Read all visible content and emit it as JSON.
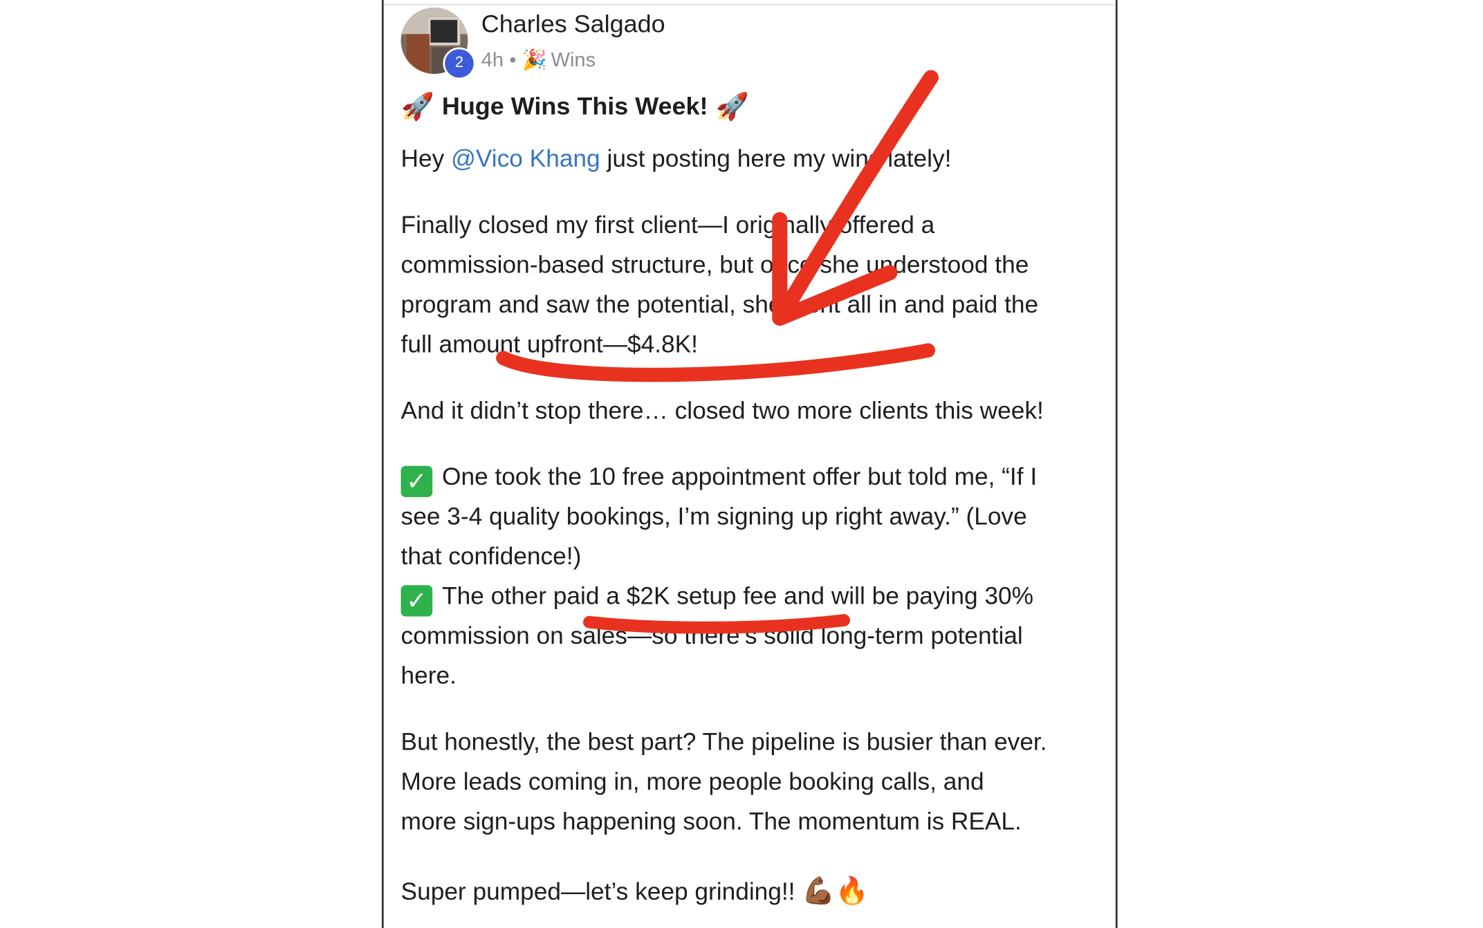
{
  "post": {
    "author": "Charles Salgado",
    "level": "2",
    "time": "4h",
    "separator": "•",
    "category_icon": "party-popper-icon",
    "category": "Wins",
    "title_icon": "rocket-icon",
    "title": "Huge Wins This Week!",
    "intro_before": "Hey ",
    "mention": "@Vico Khang",
    "intro_after": " just posting here my wins lately!",
    "p1": [
      "Finally closed my first client—I originally offered a",
      "commission-based structure, but once she understood the",
      "program and saw the potential, she went all in and paid the",
      "full amount upfront—$4.8K!"
    ],
    "p2": "And it didn’t stop there… closed two more clients this week!",
    "check_icon": "check-box-icon",
    "p3": [
      "One took the 10 free appointment offer but told me, “If I",
      "see 3-4 quality bookings, I’m signing up right away.” (Love",
      "that confidence!)"
    ],
    "p4": [
      "The other paid a $2K setup fee and will be paying 30%",
      "commission on sales—so there’s solid long-term potential",
      "here."
    ],
    "p5": [
      "But honestly, the best part? The pipeline is busier than ever.",
      "More leads coming in, more people booking calls, and",
      "more sign-ups happening soon. The momentum is REAL."
    ],
    "closing": "Super pumped—let’s keep grinding!! ",
    "closing_emojis": "💪🏾🔥"
  },
  "annotation": {
    "color": "#e8321f",
    "items": [
      "red-arrow",
      "underline-upfront-amount",
      "underline-setup-fee"
    ]
  }
}
